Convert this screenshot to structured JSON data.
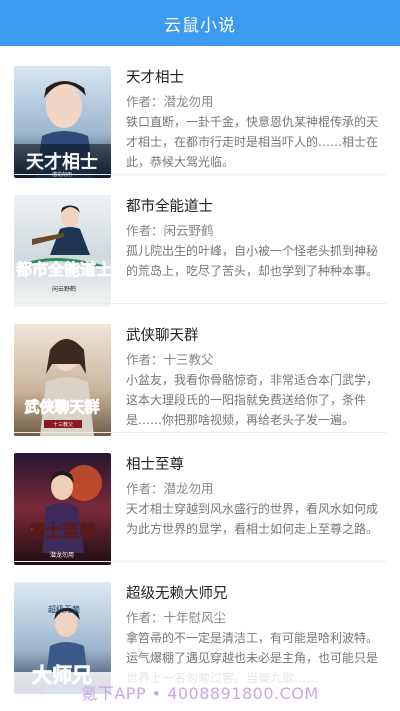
{
  "appbar": {
    "title": "云鼠小说"
  },
  "author_prefix": "作者：",
  "books": [
    {
      "title": "天才相士",
      "author": "潜龙勿用",
      "desc": "铁口直断，一卦千金，快意恩仇某神棍传承的天才相士，在都市行走时是相当吓人的……相士在此，恭候大驾光临。",
      "cover_text": "天才相士",
      "cover_sub": "潜龙勿用"
    },
    {
      "title": "都市全能道士",
      "author": "闲云野鹤",
      "desc": "孤儿院出生的叶峰，自小被一个怪老头抓到神秘的荒岛上，吃尽了苦头，却也学到了种种本事。",
      "cover_text": "都市全能道士",
      "cover_sub": "闲云野鹤"
    },
    {
      "title": "武侠聊天群",
      "author": "十三教父",
      "desc": "小盆友，我看你骨骼惊奇，非常适合本门武学，这本大理段氏的一阳指就免费送给你了，条件是……你把那啥视频，再给老头子发一遍。",
      "cover_text": "武侠聊天群",
      "cover_sub": "十三教父"
    },
    {
      "title": "相士至尊",
      "author": "潜龙勿用",
      "desc": "天才相士穿越到风水盛行的世界，看风水如何成为此方世界的显学，看相士如何走上至尊之路。",
      "cover_text": "相士至尊",
      "cover_sub": "潜龙勿用"
    },
    {
      "title": "超级无赖大师兄",
      "author": "十年慰风尘",
      "desc": "拿笤帚的不一定是清洁工，有可能是哈利波特。运气爆棚了遇见穿越也未必是主角，也可能只是世界上一名匆匆过客。当秦九歌……",
      "cover_text": "大师兄",
      "cover_sub": "超级无赖"
    }
  ],
  "watermark": {
    "text": "氪下APP • 4008891800.COM"
  },
  "colors": {
    "appbar": "#3d9af0",
    "title": "#222222",
    "meta": "#888888"
  }
}
